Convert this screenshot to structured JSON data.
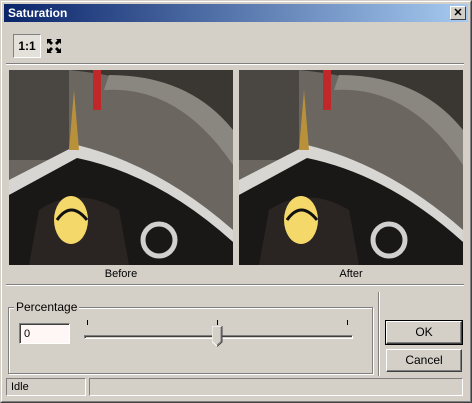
{
  "window": {
    "title": "Saturation",
    "close_glyph": "✕"
  },
  "toolbar": {
    "actual_size_label": "1:1",
    "fit_icon": "fit-to-window-icon"
  },
  "previews": {
    "before_caption": "Before",
    "after_caption": "After"
  },
  "percentage": {
    "label": "Percentage",
    "value": "0",
    "slider_position": 0.5
  },
  "buttons": {
    "ok": "OK",
    "cancel": "Cancel"
  },
  "statusbar": {
    "text": "Idle",
    "secondary": ""
  }
}
